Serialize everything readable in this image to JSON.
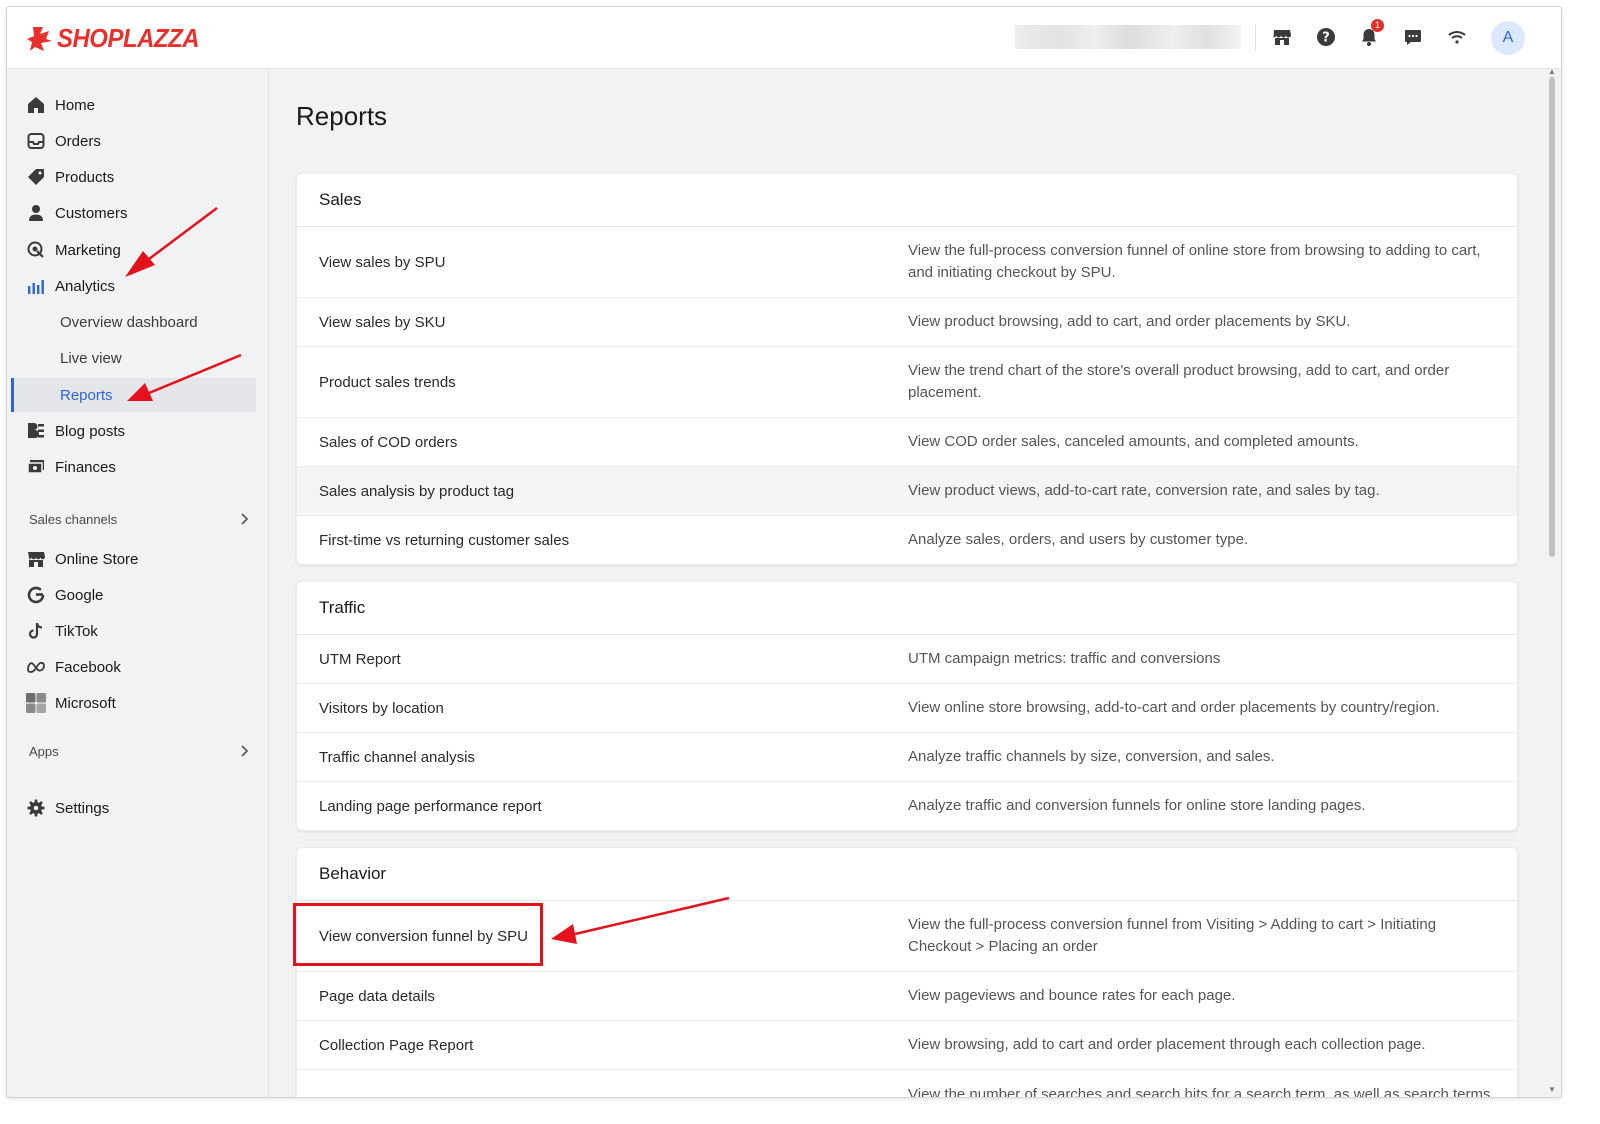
{
  "app": {
    "logo_text": "SHOPLAZZA",
    "brand_color": "#e8302d",
    "accent_color": "#2f64d6",
    "annotation_color": "#e3121c"
  },
  "topbar": {
    "icons": [
      "store-icon",
      "help-icon",
      "bell-icon",
      "chat-icon",
      "wifi-icon"
    ],
    "notification_count": "1",
    "avatar_initial": "A"
  },
  "sidebar": {
    "items": [
      {
        "label": "Home",
        "icon": "home-icon"
      },
      {
        "label": "Orders",
        "icon": "orders-icon"
      },
      {
        "label": "Products",
        "icon": "tag-icon"
      },
      {
        "label": "Customers",
        "icon": "person-icon"
      },
      {
        "label": "Marketing",
        "icon": "marketing-icon"
      },
      {
        "label": "Analytics",
        "icon": "chart-icon"
      }
    ],
    "analytics_sub": [
      {
        "label": "Overview dashboard"
      },
      {
        "label": "Live view"
      },
      {
        "label": "Reports",
        "active": true
      }
    ],
    "items_after": [
      {
        "label": "Blog posts",
        "icon": "blog-icon"
      },
      {
        "label": "Finances",
        "icon": "finances-icon"
      }
    ],
    "sales_channels_label": "Sales channels",
    "channels": [
      {
        "label": "Online Store",
        "icon": "store-icon"
      },
      {
        "label": "Google",
        "icon": "google-icon"
      },
      {
        "label": "TikTok",
        "icon": "tiktok-icon"
      },
      {
        "label": "Facebook",
        "icon": "meta-icon"
      },
      {
        "label": "Microsoft",
        "icon": "microsoft-icon"
      }
    ],
    "apps_label": "Apps",
    "settings_label": "Settings"
  },
  "main": {
    "title": "Reports",
    "sections": [
      {
        "title": "Sales",
        "rows": [
          {
            "name": "View sales by SPU",
            "desc": "View the full-process conversion funnel of online store from browsing to adding to cart, and initiating checkout by SPU."
          },
          {
            "name": "View sales by SKU",
            "desc": "View product browsing, add to cart, and order placements by SKU."
          },
          {
            "name": "Product sales trends",
            "desc": "View the trend chart of the store's overall product browsing, add to cart, and order placement."
          },
          {
            "name": "Sales of COD orders",
            "desc": "View COD order sales, canceled amounts, and completed amounts."
          },
          {
            "name": "Sales analysis by product tag",
            "desc": "View product views, add-to-cart rate, conversion rate, and sales by tag."
          },
          {
            "name": "First-time vs returning customer sales",
            "desc": "Analyze sales, orders, and users by customer type."
          }
        ]
      },
      {
        "title": "Traffic",
        "rows": [
          {
            "name": "UTM Report",
            "desc": "UTM campaign metrics: traffic and conversions"
          },
          {
            "name": "Visitors by location",
            "desc": "View online store browsing, add-to-cart and order placements by country/region."
          },
          {
            "name": "Traffic channel analysis",
            "desc": "Analyze traffic channels by size, conversion, and sales."
          },
          {
            "name": "Landing page performance report",
            "desc": "Analyze traffic and conversion funnels for online store landing pages."
          }
        ]
      },
      {
        "title": "Behavior",
        "rows": [
          {
            "name": "View conversion funnel by SPU",
            "desc": "View the full-process conversion funnel from Visiting > Adding to cart > Initiating Checkout > Placing an order"
          },
          {
            "name": "Page data details",
            "desc": "View pageviews and bounce rates for each page."
          },
          {
            "name": "Collection Page Report",
            "desc": "View browsing, add to cart and order placement through each collection page."
          },
          {
            "name": "",
            "desc": "View the number of searches and search hits for a search term, as well as search terms"
          }
        ]
      }
    ]
  }
}
